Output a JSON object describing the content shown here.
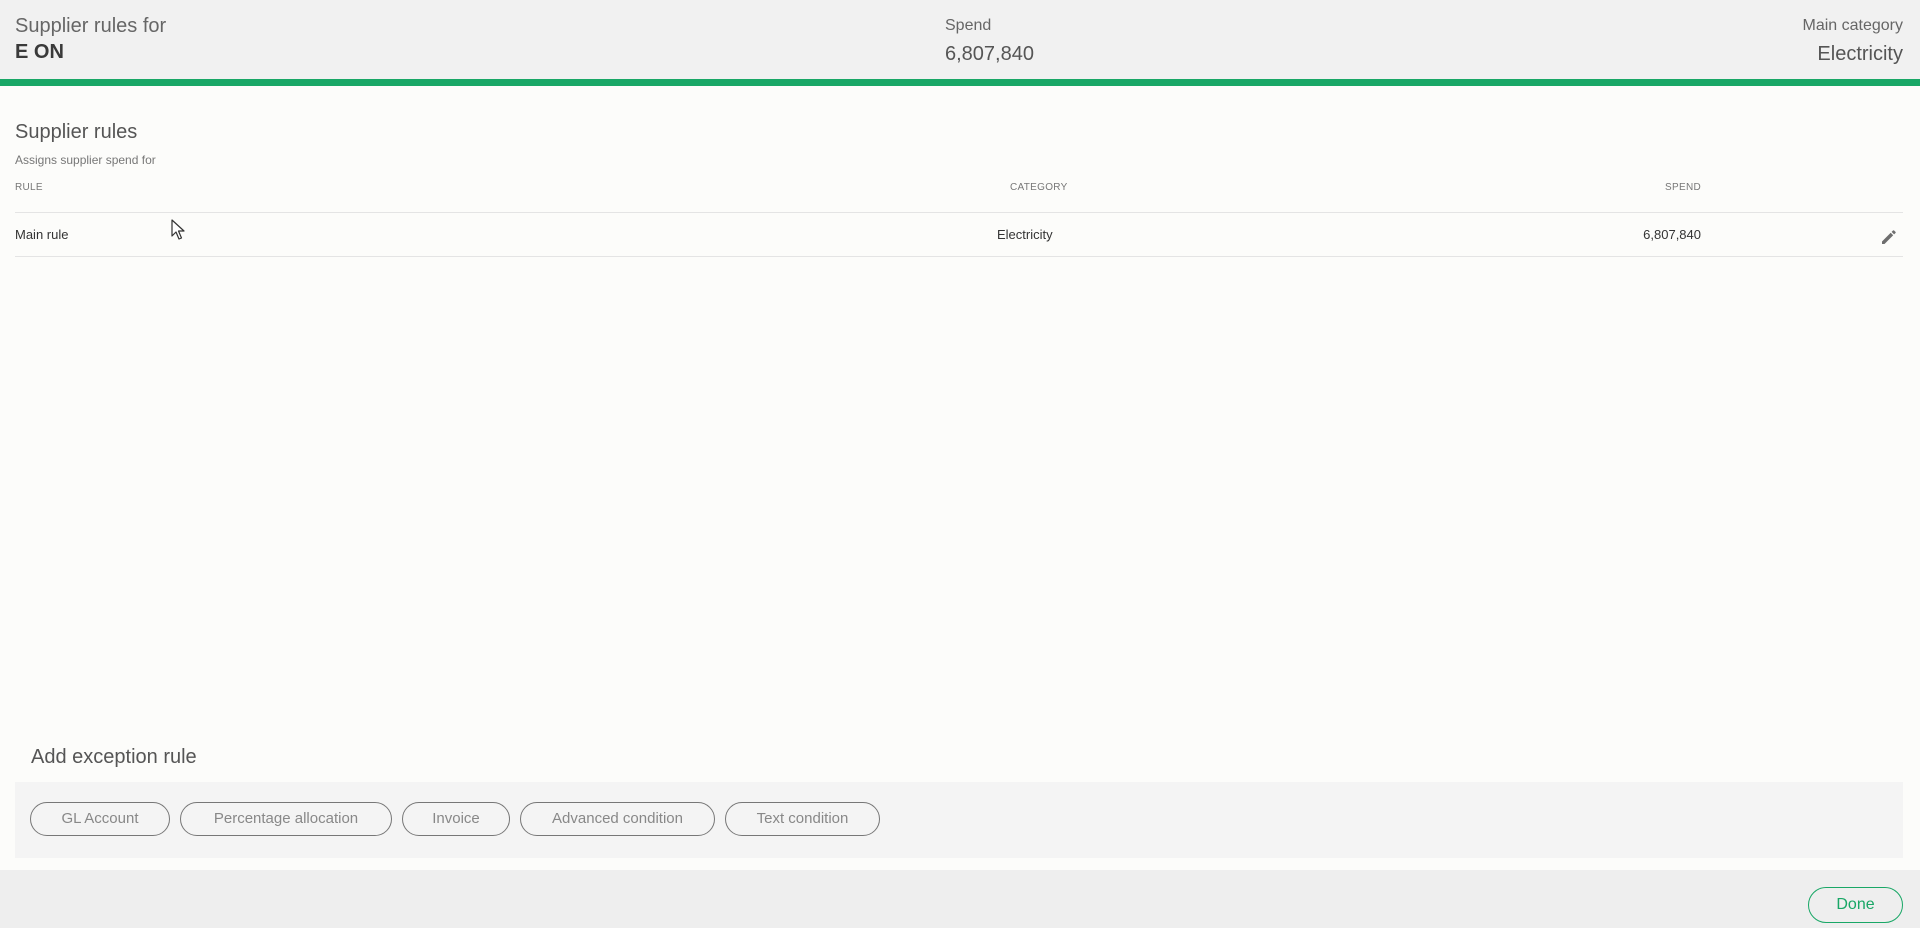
{
  "header": {
    "title_line1": "Supplier rules for",
    "supplier_name": "E ON",
    "spend_label": "Spend",
    "spend_value": "6,807,840",
    "category_label": "Main category",
    "category_value": "Electricity",
    "accent_color": "#19a766"
  },
  "section": {
    "title": "Supplier rules",
    "subtitle": "Assigns supplier spend for"
  },
  "table": {
    "columns": {
      "rule": "RULE",
      "category": "CATEGORY",
      "spend": "SPEND"
    },
    "rows": [
      {
        "rule": "Main rule",
        "category": "Electricity",
        "spend": "6,807,840",
        "action_icon": "pencil-icon"
      }
    ]
  },
  "exceptions": {
    "title": "Add exception rule",
    "buttons": [
      "GL Account",
      "Percentage allocation",
      "Invoice",
      "Advanced condition",
      "Text condition"
    ]
  },
  "footer": {
    "done_label": "Done"
  }
}
